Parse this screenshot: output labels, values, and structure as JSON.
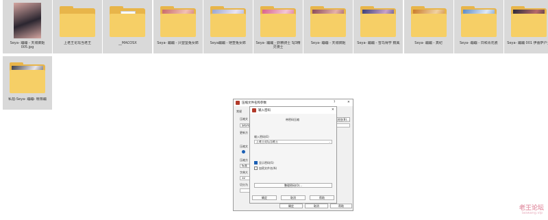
{
  "tiles": [
    {
      "kind": "image",
      "caption": "Seya- 蹦蹦 - 天城御姬 005.jpg",
      "colors": [
        "#2b2630",
        "#d4a5a0"
      ]
    },
    {
      "kind": "folder",
      "caption": "上老王论坛当老王",
      "colors": []
    },
    {
      "kind": "folder-doc",
      "caption": "__MACOSX",
      "colors": []
    },
    {
      "kind": "folder-pic",
      "caption": "Seya- 蹦蹦 - 兴登堡兔女郎",
      "colors": [
        "#c86a6a",
        "#f2c1b4"
      ]
    },
    {
      "kind": "folder-pic",
      "caption": "Seya蹦蹦 - 铠查兔女郎",
      "colors": [
        "#9aa6cf",
        "#eae4f2"
      ]
    },
    {
      "kind": "folder-pic",
      "caption": "Seya- 蹦蹦 - 妖精骑士 SJ3精灵骑士",
      "colors": [
        "#d8608a",
        "#f3c7d5"
      ]
    },
    {
      "kind": "folder-pic",
      "caption": "Seya- 蹦蹦 - 天城御姬",
      "colors": [
        "#8a4a5a",
        "#e6b1a8"
      ]
    },
    {
      "kind": "folder-pic",
      "caption": "Seya- 蹦蹦 - 雪鸟得学 鏡風",
      "colors": [
        "#3a3f7a",
        "#c9a2c8"
      ]
    },
    {
      "kind": "folder-pic",
      "caption": "Seya- 蹦蹦 - 真纪",
      "colors": [
        "#c97a2a",
        "#f0d2a2"
      ]
    },
    {
      "kind": "folder-pic",
      "caption": "Seya- 蹦蹦 - 日和青花瓷",
      "colors": [
        "#5a8ac8",
        "#dfe9f5"
      ]
    },
    {
      "kind": "folder-pic",
      "caption": "Seya- 蹦蹦 001 伊蕾萨户士",
      "colors": [
        "#2a2a3a",
        "#b86a6a"
      ]
    },
    {
      "kind": "folder-pic",
      "caption": "私拍-Seya- 蹦蹦- 帐橡蹦",
      "colors": [
        "#404048",
        "#e9e6ea"
      ]
    }
  ],
  "archive_dialog": {
    "title": "压缩文件名和参数",
    "tab_general": "常规",
    "label_archive": "压缩文",
    "field_archive": "Seya-蹦",
    "label_update": "更新方",
    "label_format": "压缩文",
    "label_method": "压缩方",
    "method_value": "标准",
    "label_dict": "字典大",
    "dict_value": "32",
    "label_split": "切分为",
    "browse": "浏览(B)...",
    "help": "?",
    "close": "✕",
    "ok": "确定",
    "cancel": "取消",
    "help_btn": "帮助"
  },
  "password_dialog": {
    "title": "输入密码",
    "heading": "带密码压缩",
    "label_password": "输入密码(E)",
    "password_value": "上老王论坛当老王",
    "show_password": "显示密码(S)",
    "show_password_checked": true,
    "encrypt_names": "加密文件名(N)",
    "encrypt_names_checked": false,
    "organize": "整理密码(O)...",
    "ok": "确定",
    "cancel": "取消",
    "help": "帮助",
    "close": "✕"
  },
  "watermark": {
    "text": "老王论坛",
    "url": "laowang.vip"
  }
}
